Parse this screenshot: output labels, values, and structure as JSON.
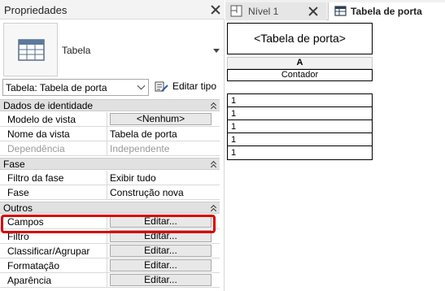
{
  "properties_panel": {
    "title": "Propriedades",
    "type_name": "Tabela",
    "instance_selector": "Tabela: Tabela de porta",
    "edit_type_label": "Editar tipo",
    "sections": [
      {
        "label": "Dados de identidade",
        "rows": [
          {
            "name": "Modelo de vista",
            "value": "<Nenhum>",
            "kind": "button"
          },
          {
            "name": "Nome da vista",
            "value": "Tabela de porta",
            "kind": "text"
          },
          {
            "name": "Dependência",
            "value": "Independente",
            "kind": "disabled"
          }
        ]
      },
      {
        "label": "Fase",
        "rows": [
          {
            "name": "Filtro da fase",
            "value": "Exibir tudo",
            "kind": "text"
          },
          {
            "name": "Fase",
            "value": "Construção nova",
            "kind": "text"
          }
        ]
      },
      {
        "label": "Outros",
        "rows": [
          {
            "name": "Campos",
            "value": "Editar...",
            "kind": "button"
          },
          {
            "name": "Filtro",
            "value": "Editar...",
            "kind": "button"
          },
          {
            "name": "Classificar/Agrupar",
            "value": "Editar...",
            "kind": "button"
          },
          {
            "name": "Formatação",
            "value": "Editar...",
            "kind": "button"
          },
          {
            "name": "Aparência",
            "value": "Editar...",
            "kind": "button"
          }
        ]
      }
    ],
    "highlight_color": "#d90000"
  },
  "view_tabs": [
    {
      "label": "Nível 1",
      "icon": "floor-plan-icon",
      "active": false
    },
    {
      "label": "Tabela de porta",
      "icon": "schedule-icon",
      "active": true
    }
  ],
  "schedule": {
    "title": "<Tabela de porta>",
    "column_letter": "A",
    "column_header": "Contador",
    "rows": [
      "1",
      "1",
      "1",
      "1",
      "1"
    ]
  }
}
